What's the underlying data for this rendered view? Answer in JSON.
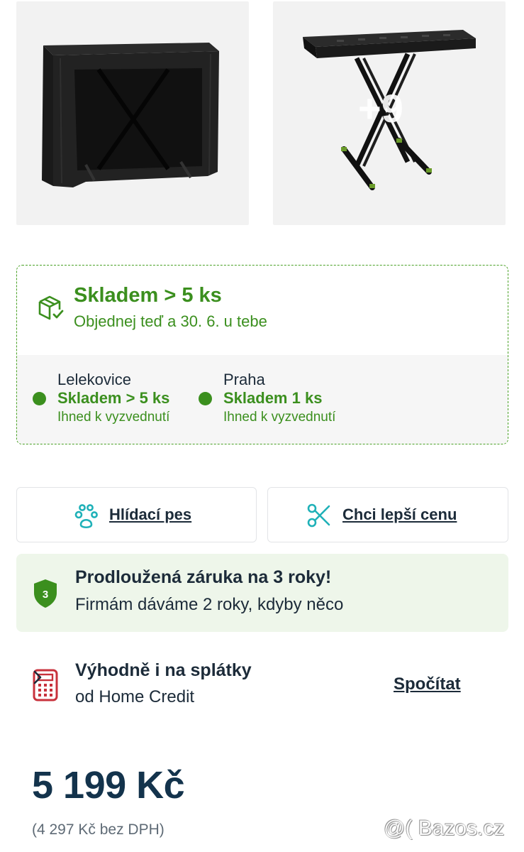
{
  "gallery": {
    "more_photos_label": "+9"
  },
  "stock": {
    "title": "Skladem > 5 ks",
    "subtitle": "Objednej teď a 30. 6. u tebe",
    "stores": [
      {
        "city": "Lelekovice",
        "status": "Skladem > 5 ks",
        "pickup": "Ihned k vyzvednutí"
      },
      {
        "city": "Praha",
        "status": "Skladem 1 ks",
        "pickup": "Ihned k vyzvednutí"
      }
    ]
  },
  "actions": {
    "watchdog_label": "Hlídací pes",
    "better_price_label": "Chci lepší cenu"
  },
  "warranty": {
    "badge_number": "3",
    "title": "Prodloužená záruka na 3 roky!",
    "subtitle": "Firmám dáváme 2 roky, kdyby něco"
  },
  "installments": {
    "title": "Výhodně i na splátky",
    "subtitle": "od Home Credit",
    "link_label": "Spočítat"
  },
  "pricing": {
    "price": "5 199 Kč",
    "price_without_vat": "(4 297 Kč bez DPH)"
  },
  "watermark": {
    "text": "@( Bazos.cz"
  },
  "colors": {
    "accent_green": "#3b8f1e",
    "teal_icon": "#1fb1b8",
    "calculator_red": "#c8323c",
    "text_dark": "#1c2b39"
  },
  "icons": [
    "box-check-icon",
    "paw-icon",
    "scissors-icon",
    "shield-icon",
    "calculator-icon",
    "chevron-right-icon"
  ]
}
